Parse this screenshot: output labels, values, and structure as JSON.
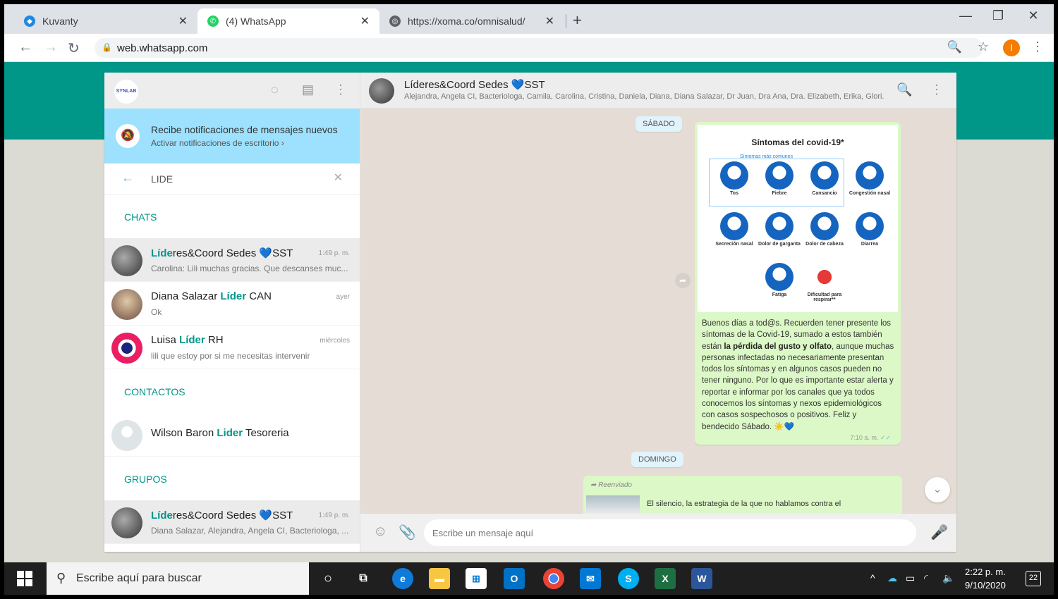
{
  "browser": {
    "tabs": [
      {
        "title": "Kuvanty",
        "active": false
      },
      {
        "title": "(4) WhatsApp",
        "active": true
      },
      {
        "title": "https://xoma.co/omnisalud/",
        "active": false
      }
    ],
    "url": "web.whatsapp.com",
    "profile_initial": "I"
  },
  "sidebar": {
    "logo_text": "SYNLAB",
    "notification": {
      "title": "Recibe notificaciones de mensajes nuevos",
      "subtitle": "Activar notificaciones de escritorio ›"
    },
    "search_query": "LIDE",
    "sections": {
      "chats": "CHATS",
      "contacts": "CONTACTOS",
      "groups": "GRUPOS"
    },
    "chats": [
      {
        "name_hl": "Líde",
        "name_rest": "res&Coord Sedes ",
        "name_tail": "SST",
        "time": "1:49 p. m.",
        "preview": "Carolina: Lili muchas gracias. Que descanses muc..."
      },
      {
        "name_pre": "Diana Salazar ",
        "name_hl": "Líder",
        "name_rest": " CAN",
        "time": "ayer",
        "preview": "Ok"
      },
      {
        "name_pre": "Luisa ",
        "name_hl": "Líder",
        "name_rest": " RH",
        "time": "miércoles",
        "preview": "lili que estoy por si me necesitas intervenir"
      }
    ],
    "contacts": [
      {
        "name_pre": "Wilson Baron ",
        "name_hl": "Lider",
        "name_rest": " Tesoreria"
      }
    ],
    "groups": [
      {
        "name_hl": "Líde",
        "name_rest": "res&Coord Sedes ",
        "name_tail": "SST",
        "time": "1:49 p. m.",
        "preview": "Diana Salazar, Alejandra, Angela CI, Bacteriologa, ..."
      }
    ]
  },
  "conversation": {
    "name_pre": "Líderes&Coord Sedes ",
    "name_tail": "SST",
    "members": "Alejandra, Angela CI, Bacteriologa, Camila, Carolina, Cristina, Daniela, Diana, Diana Salazar, Dr Juan, Dra Ana, Dra. Elizabeth, Erika, Glori...",
    "day1": "SÁBADO",
    "day2": "DOMINGO",
    "poster": {
      "title": "Síntomas del covid-19*",
      "subtitle": "Síntomas más comunes",
      "symptoms": [
        "Tos",
        "Fiebre",
        "Cansancio",
        "Congestión nasal",
        "Secreción nasal",
        "Dolor de garganta",
        "Dolor de cabeza",
        "Diarrea",
        "Fatiga",
        "Dificultad para respirar**"
      ]
    },
    "caption_part1": "Buenos días a tod@s. Recuerden tener presente los síntomas de la Covid-19, sumado a estos también están ",
    "caption_bold": "la pérdida del gusto y olfato",
    "caption_part2": ", aunque muchas personas infectadas no necesariamente presentan todos los síntomas y en algunos casos pueden no tener ninguno. Por lo que es importante estar alerta y reportar e informar por los canales que ya todos conocemos los síntomas y nexos epidemiológicos con casos sospechosos o positivos. Feliz y bendecido Sábado. ☀️",
    "msg_time": "7:10 a. m.",
    "forwarded_label": "Reenviado",
    "forwarded_text": "El silencio, la estrategia de la que no hablamos contra el",
    "composer_placeholder": "Escribe un mensaje aquí"
  },
  "taskbar": {
    "search_text": "Escribe aquí para buscar",
    "time": "2:22 p. m.",
    "date": "9/10/2020",
    "notifications": "22"
  }
}
